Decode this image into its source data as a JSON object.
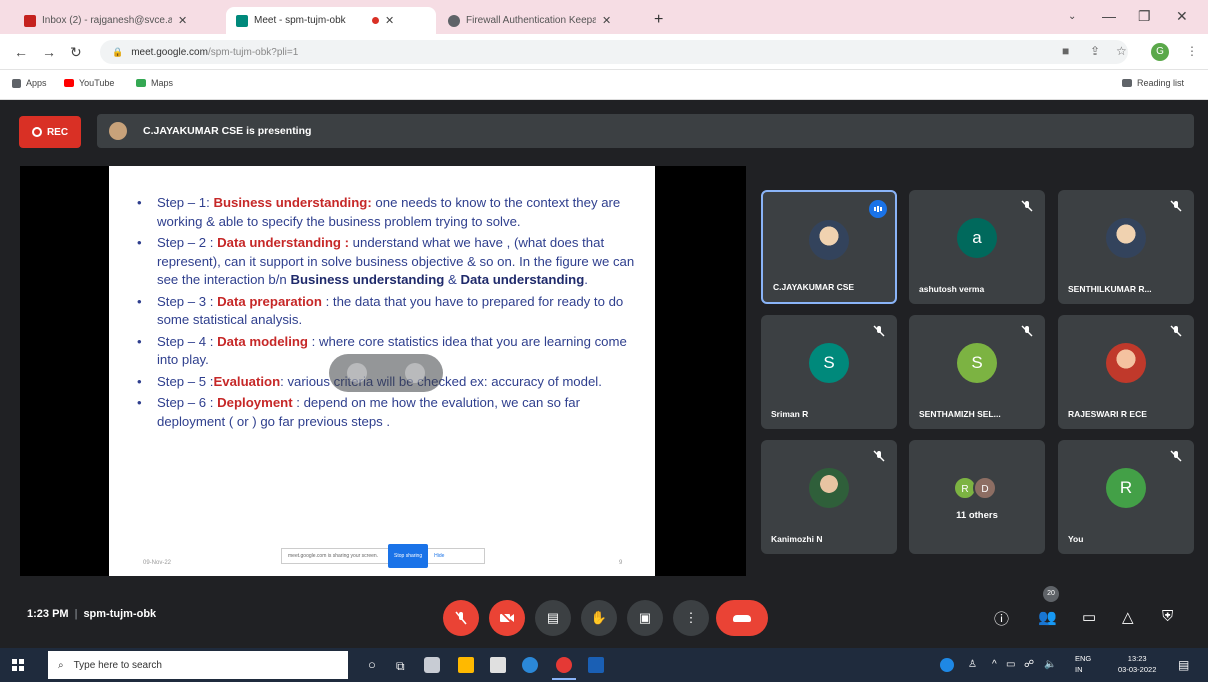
{
  "browser": {
    "tabs": [
      {
        "title": "Inbox (2) - rajganesh@svce.a",
        "fav_color": "#c5221f"
      },
      {
        "title": "Meet - spm-tujm-obk",
        "fav_color": "#00897b"
      },
      {
        "title": "Firewall Authentication Keepali",
        "fav_color": "#5f6368"
      }
    ],
    "new_tab": "+",
    "url_host": "meet.google.com",
    "url_path": "/spm-tujm-obk?pli=1",
    "profile_initial": "G",
    "bookmarks": [
      {
        "label": "Apps",
        "color": "#5f6368"
      },
      {
        "label": "YouTube",
        "color": "#ff0000"
      },
      {
        "label": "Maps",
        "color": "#34a853"
      }
    ],
    "reading_list": "Reading list"
  },
  "meet": {
    "rec_label": "REC",
    "presenting_text": "C.JAYAKUMAR CSE is presenting",
    "slide": {
      "steps": [
        {
          "prefix": "Step – 1: ",
          "keyword": "Business understanding:",
          "text": " one needs to know to the context they are working & able to specify the business problem trying to solve."
        },
        {
          "prefix": "Step – 2 : ",
          "keyword": "Data understanding :",
          "text": " understand what we have , (what does that represent), can it support in solve business objective & so on. In the figure we can see the interaction b/n ",
          "bold1": "Business understanding",
          "amp": " & ",
          "bold2": "Data understanding",
          "end": "."
        },
        {
          "prefix": "Step – 3 : ",
          "keyword": "Data preparation",
          "text": " : the data that you have to prepared  for ready to do some statistical analysis."
        },
        {
          "prefix": "Step – 4 : ",
          "keyword": "Data modeling",
          "text": " : where core statistics idea that you are learning come into play."
        },
        {
          "prefix": "Step – 5 :",
          "keyword": "Evaluation",
          "text": ": various criteria will be checked ex: accuracy of model."
        },
        {
          "prefix": "Step – 6 : ",
          "keyword": "Deployment",
          "text": " : depend on me how the evalution, we can so far deployment  ( or ) go far previous steps ."
        }
      ],
      "footer_date": "09-Nov-22",
      "share_text": "meet.google.com is sharing your screen.",
      "stop_label": "Stop sharing",
      "hide_label": "Hide",
      "page_number": "9"
    },
    "participants": [
      {
        "name": "C.JAYAKUMAR CSE",
        "initial": "",
        "color": "",
        "photo": true
      },
      {
        "name": "ashutosh verma",
        "initial": "a",
        "color": "#00695c",
        "photo": false
      },
      {
        "name": "SENTHILKUMAR R...",
        "initial": "",
        "color": "",
        "photo": true
      },
      {
        "name": "Sriman R",
        "initial": "S",
        "color": "#00897b",
        "photo": false
      },
      {
        "name": "SENTHAMIZH SEL...",
        "initial": "S",
        "color": "#7cb342",
        "photo": false
      },
      {
        "name": "RAJESWARI R ECE",
        "initial": "",
        "color": "",
        "photo": true
      },
      {
        "name": "Kanimozhi N",
        "initial": "",
        "color": "",
        "photo": true
      },
      {
        "name": "",
        "initial": "",
        "color": "",
        "photo": false
      },
      {
        "name": "You",
        "initial": "R",
        "color": "#43a047",
        "photo": false
      }
    ],
    "others": {
      "initials": [
        {
          "letter": "R",
          "color": "#7cb342"
        },
        {
          "letter": "D",
          "color": "#8d6e63"
        }
      ],
      "label": "11 others"
    },
    "time": "1:23 PM",
    "meeting_code": "spm-tujm-obk",
    "participant_count": "20"
  },
  "taskbar": {
    "search_placeholder": "Type here to search",
    "language_top": "ENG",
    "language_bottom": "IN",
    "clock_time": "13:23",
    "clock_date": "03-03-2022"
  }
}
